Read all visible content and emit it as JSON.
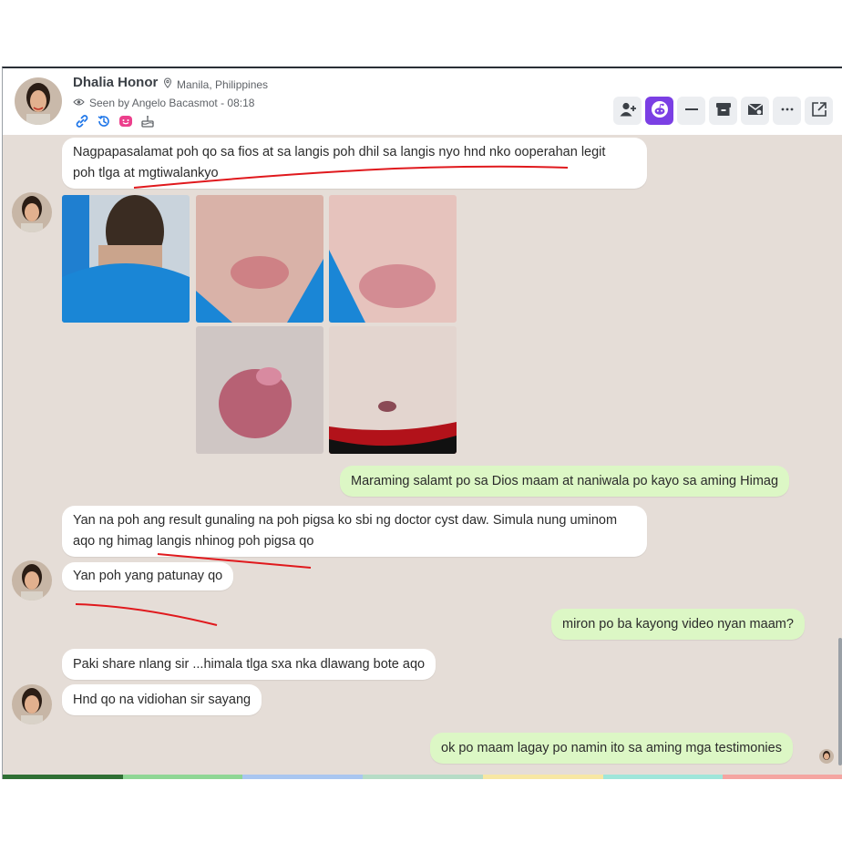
{
  "header": {
    "name": "Dhalia Honor",
    "location": "Manila, Philippines",
    "seen": "Seen by Angelo Bacasmot - 08:18"
  },
  "icons": [
    "link-icon",
    "history-icon",
    "smile-icon",
    "cake-icon"
  ],
  "toolbar": [
    "add-user-icon",
    "reddit-icon",
    "minus-icon",
    "archive-icon",
    "inbox-icon",
    "more-icon",
    "external-link-icon"
  ],
  "messages": {
    "m1": "Nagpapasalamat poh qo sa fios at sa langis poh dhil sa langis nyo hnd nko ooperahan legit",
    "m1b": "poh tlga at mgtiwalankyo",
    "m2": "Maraming salamt po sa Dios maam at naniwala po kayo sa aming Himag",
    "m3": "Yan na poh ang result gunaling na poh pigsa ko sbi ng doctor cyst daw. Simula nung uminom",
    "m3b": "aqo ng himag langis nhinog poh pigsa qo",
    "m4": "Yan poh yang patunay qo",
    "m5": "miron po ba kayong video nyan maam?",
    "m6": "Paki share nlang sir ...himala tlga sxa nka dlawang bote aqo",
    "m7": "Hnd qo na vidiohan sir sayang",
    "m8": "ok po maam lagay po namin ito sa aming mga testimonies"
  },
  "colors": {
    "accent": "#7b3fe4",
    "incoming": "#ffffff",
    "outgoing": "#dcf7c5",
    "background": "#e5ddd7",
    "annotation": "#e0191d",
    "progress": [
      "#2f6f34",
      "#8fd694",
      "#a9c6f0",
      "#b6dcc6",
      "#f7e7a3",
      "#9fe6da",
      "#f4a5a1"
    ]
  }
}
